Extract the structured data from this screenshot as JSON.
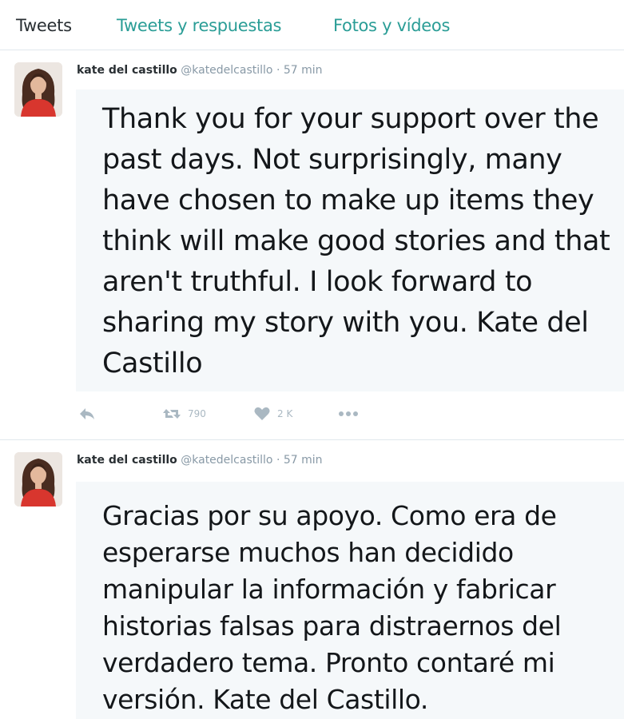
{
  "tabs": {
    "tweets": "Tweets",
    "replies": "Tweets y respuestas",
    "media": "Fotos y vídeos"
  },
  "tweets": [
    {
      "name": "kate del castillo",
      "handle": "@katedelcastillo",
      "separator": "·",
      "time": "57 min",
      "text": "Thank you for your support over the past days. Not surprisingly, many have chosen to make up items they think will make good stories and that aren't truthful. I look forward to sharing my story with you. Kate del Castillo",
      "retweets": "790",
      "likes": "2 K"
    },
    {
      "name": "kate del castillo",
      "handle": "@katedelcastillo",
      "separator": "·",
      "time": "57 min",
      "text": "Gracias por su apoyo. Como era de esperarse muchos han decidido manipular la información y fabricar historias falsas para distraernos del verdadero tema. Pronto contaré mi versión. Kate del Castillo."
    }
  ],
  "colors": {
    "accent": "#2a9d96",
    "text": "#14171a",
    "muted": "#8899a6",
    "icon": "#aab8c2",
    "body_bg": "#f5f8fa",
    "border": "#e1e8ed"
  },
  "icons": {
    "reply": "reply-icon",
    "retweet": "retweet-icon",
    "like": "heart-icon",
    "more": "more-icon"
  }
}
